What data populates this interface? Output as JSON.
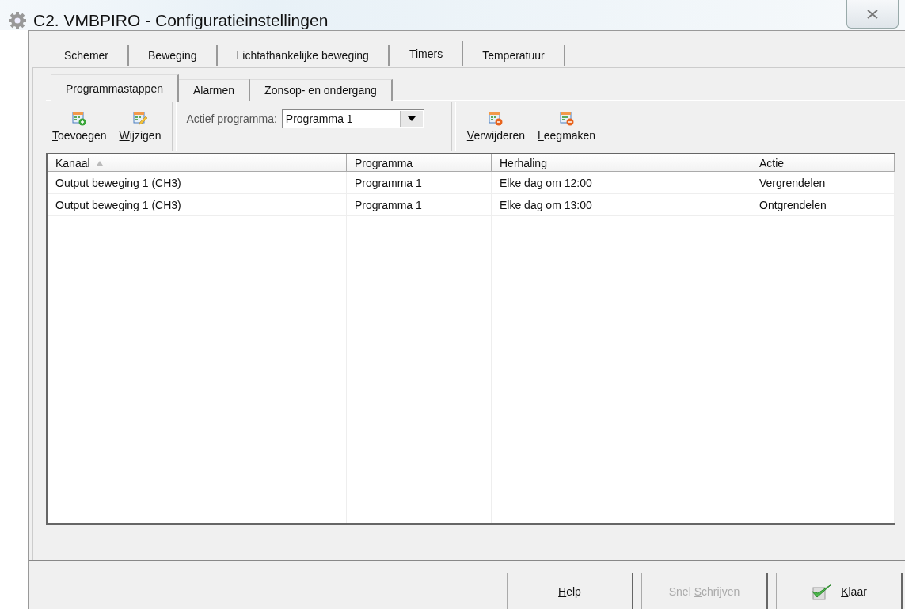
{
  "window": {
    "title": "C2. VMBPIRO - Configuratieinstellingen"
  },
  "tabs": [
    {
      "label": "Schemer",
      "selected": false
    },
    {
      "label": "Beweging",
      "selected": false
    },
    {
      "label": "Lichtafhankelijke beweging",
      "selected": false
    },
    {
      "label": "Timers",
      "selected": true
    },
    {
      "label": "Temperatuur",
      "selected": false
    }
  ],
  "subtabs": [
    {
      "label": "Programmastappen",
      "selected": true
    },
    {
      "label": "Alarmen",
      "selected": false
    },
    {
      "label": "Zonsop- en ondergang",
      "selected": false
    }
  ],
  "toolbar_left": [
    {
      "kind": "add",
      "label": {
        "key": "T",
        "after": "oevoegen"
      }
    },
    {
      "kind": "edit",
      "label": {
        "key": "W",
        "after": "ijzigen"
      }
    }
  ],
  "program_select": {
    "label": "Actief programma:",
    "value": "Programma 1"
  },
  "toolbar_right": [
    {
      "kind": "remove",
      "label": {
        "key": "V",
        "after": "erwijderen"
      }
    },
    {
      "kind": "remove",
      "label": {
        "key": "L",
        "after": "eegmaken"
      }
    }
  ],
  "table": {
    "columns": [
      {
        "label": "Kanaal",
        "sorted": true
      },
      {
        "label": "Programma",
        "sorted": false
      },
      {
        "label": "Herhaling",
        "sorted": false
      },
      {
        "label": "Actie",
        "sorted": false
      }
    ],
    "rows": [
      [
        "Output beweging 1 (CH3)",
        "Programma 1",
        "Elke dag om 12:00",
        "Vergrendelen"
      ],
      [
        "Output beweging 1 (CH3)",
        "Programma 1",
        "Elke dag om 13:00",
        "Ontgrendelen"
      ]
    ]
  },
  "buttons": [
    {
      "label": {
        "key": "H",
        "after": "elp"
      },
      "disabled": false,
      "kind": "plain"
    },
    {
      "label": {
        "before": "Snel ",
        "key": "S",
        "after": "chrijven"
      },
      "disabled": true,
      "kind": "plain"
    },
    {
      "label": {
        "key": "K",
        "after": "laar"
      },
      "disabled": false,
      "kind": "ok"
    }
  ]
}
